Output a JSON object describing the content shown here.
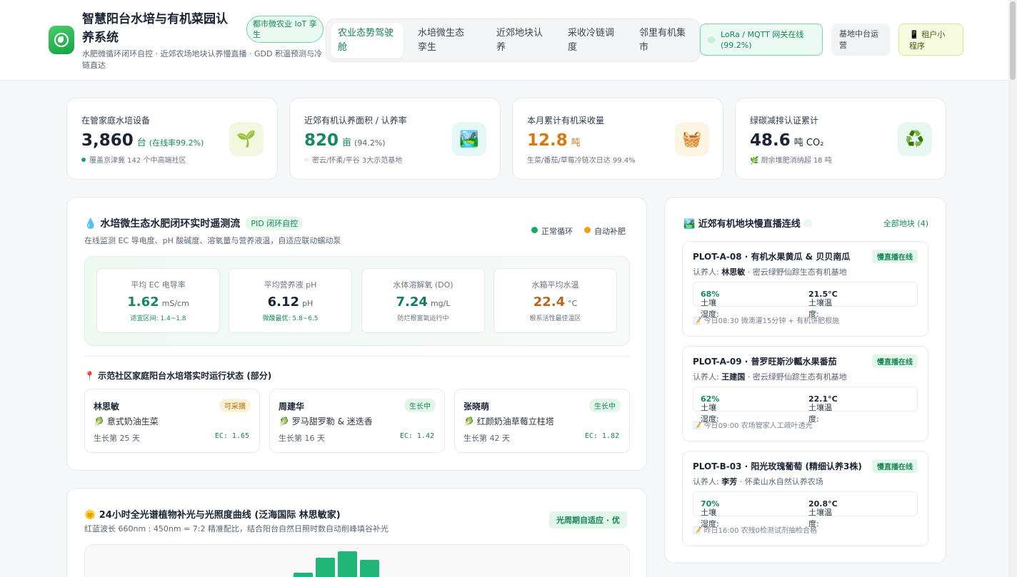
{
  "header": {
    "title": "智慧阳台水培与有机菜园认养系统",
    "badge": "都市微农业 IoT 孪生",
    "subtitle": "水肥微循环闭环自控 · 近郊农场地块认养慢直播 · GDD 积温预测与冷链直达",
    "nav": [
      "农业态势驾驶舱",
      "水培微生态孪生",
      "近郊地块认养",
      "采收冷链调度",
      "邻里有机集市"
    ],
    "gateway": "LoRa / MQTT 网关在线 (99.2%)",
    "hub": "基地中台运营",
    "mini": "租户小程序",
    "mini_icon": "📱"
  },
  "stats": [
    {
      "label": "在管家庭水培设备",
      "value": "3,860",
      "unit": "台",
      "extra": "(在线率99.2%)",
      "note": "覆盖京津冀 142 个中高端社区",
      "icon": "🌱",
      "color": "#1a2433"
    },
    {
      "label": "近郊有机认养面积 / 认养率",
      "value": "820",
      "unit": "亩",
      "extra": "(94.2%)",
      "note": "密云/怀柔/平谷 3大示范基地",
      "icon": "🏞️",
      "color": "#158a5a"
    },
    {
      "label": "本月累计有机采收量",
      "value": "12.8",
      "unit": "吨",
      "extra": "",
      "note": "生菜/番茄/草莓冷链次日达 99.4%",
      "icon": "🧺",
      "color": "#d9780f"
    },
    {
      "label": "绿碳减排认证累计",
      "value": "48.6",
      "unit": "吨 CO₂",
      "extra": "",
      "note": "厨余堆肥消纳超 18 吨",
      "icon": "♻️",
      "color": "#1a2433"
    }
  ],
  "hydro": {
    "title": "水培微生态水肥闭环实时遥测流",
    "icon": "💧",
    "tag": "PID 闭环自控",
    "subtitle": "在线监测 EC 导电度、pH 酸碱度、溶氧量与营养液温，自适应联动蠕动泵",
    "legend": [
      "正常循环",
      "自动补肥"
    ],
    "metrics": [
      {
        "label": "平均 EC 电导率",
        "value": "1.62",
        "unit": "mS/cm",
        "note": "适宜区间: 1.4~1.8"
      },
      {
        "label": "平均营养液 pH",
        "value": "6.12",
        "unit": "pH",
        "note": "微酸最优: 5.8~6.5"
      },
      {
        "label": "水体溶解氧 (DO)",
        "value": "7.24",
        "unit": "mg/L",
        "note": "防烂根富氧运行中"
      },
      {
        "label": "水箱平均水温",
        "value": "22.4",
        "unit": "°C",
        "note": "根系活性最佳温区"
      }
    ],
    "towers_title": "示范社区家庭阳台水培塔实时运行状态 (部分)",
    "towers": [
      {
        "name": "林思敏",
        "status": "可采摘",
        "plant": "意式奶油生菜",
        "days": "生长第 25 天",
        "ec": "EC: 1.65"
      },
      {
        "name": "周建华",
        "status": "生长中",
        "plant": "罗马甜罗勒 & 迷迭香",
        "days": "生长第 16 天",
        "ec": "EC: 1.42"
      },
      {
        "name": "张晓萌",
        "status": "生长中",
        "plant": "红颜奶油草莓立柱塔",
        "days": "生长第 42 天",
        "ec": "EC: 1.82"
      }
    ]
  },
  "light": {
    "title": "24小时全光谱植物补光与光照度曲线 (泛海国际 林思敏家)",
    "icon": "🌞",
    "subtitle": "红蓝波长 660nm : 450nm = 7:2 精准配比，结合阳台自然日照时数自动削峰填谷补光",
    "badge": "光周期自适应 · 优"
  },
  "chart_data": {
    "type": "bar",
    "partially_visible": true,
    "values": [
      0.35,
      0.7,
      0.85,
      0.65,
      0.25
    ]
  },
  "plots": {
    "title": "近郊有机地块慢直播连线",
    "icon": "🏞️",
    "all_label": "全部地块 (4)",
    "items": [
      {
        "title": "PLOT-A-08 · 有机水果黄瓜 & 贝贝南瓜",
        "badge": "慢直播在线",
        "owner": "林思敏",
        "farm": " · 密云绿野仙踪生态有机基地",
        "moist_label": "土壤湿度: ",
        "moist": "68%",
        "temp_label": "土壤温度: ",
        "temp": "21.5°C",
        "log": "今日08:30 微滴灌15分钟 + 有机饼肥根施"
      },
      {
        "title": "PLOT-A-09 · 普罗旺斯沙瓤水果番茄",
        "badge": "慢直播在线",
        "owner": "王建国",
        "farm": " · 密云绿野仙踪生态有机基地",
        "moist_label": "土壤湿度: ",
        "moist": "62%",
        "temp_label": "土壤温度: ",
        "temp": "22.1°C",
        "log": "今日09:00 农场管家人工疏叶透光"
      },
      {
        "title": "PLOT-B-03 · 阳光玫瑰葡萄 (精细认养3株)",
        "badge": "慢直播在线",
        "owner": "李芳",
        "farm": " · 怀柔山水自然认养农场",
        "moist_label": "土壤湿度: ",
        "moist": "70%",
        "temp_label": "土壤温度: ",
        "temp": "20.8°C",
        "log": "昨日16:00 农残0检测试剂抽检合格"
      }
    ],
    "owner_label": "认养人: "
  }
}
